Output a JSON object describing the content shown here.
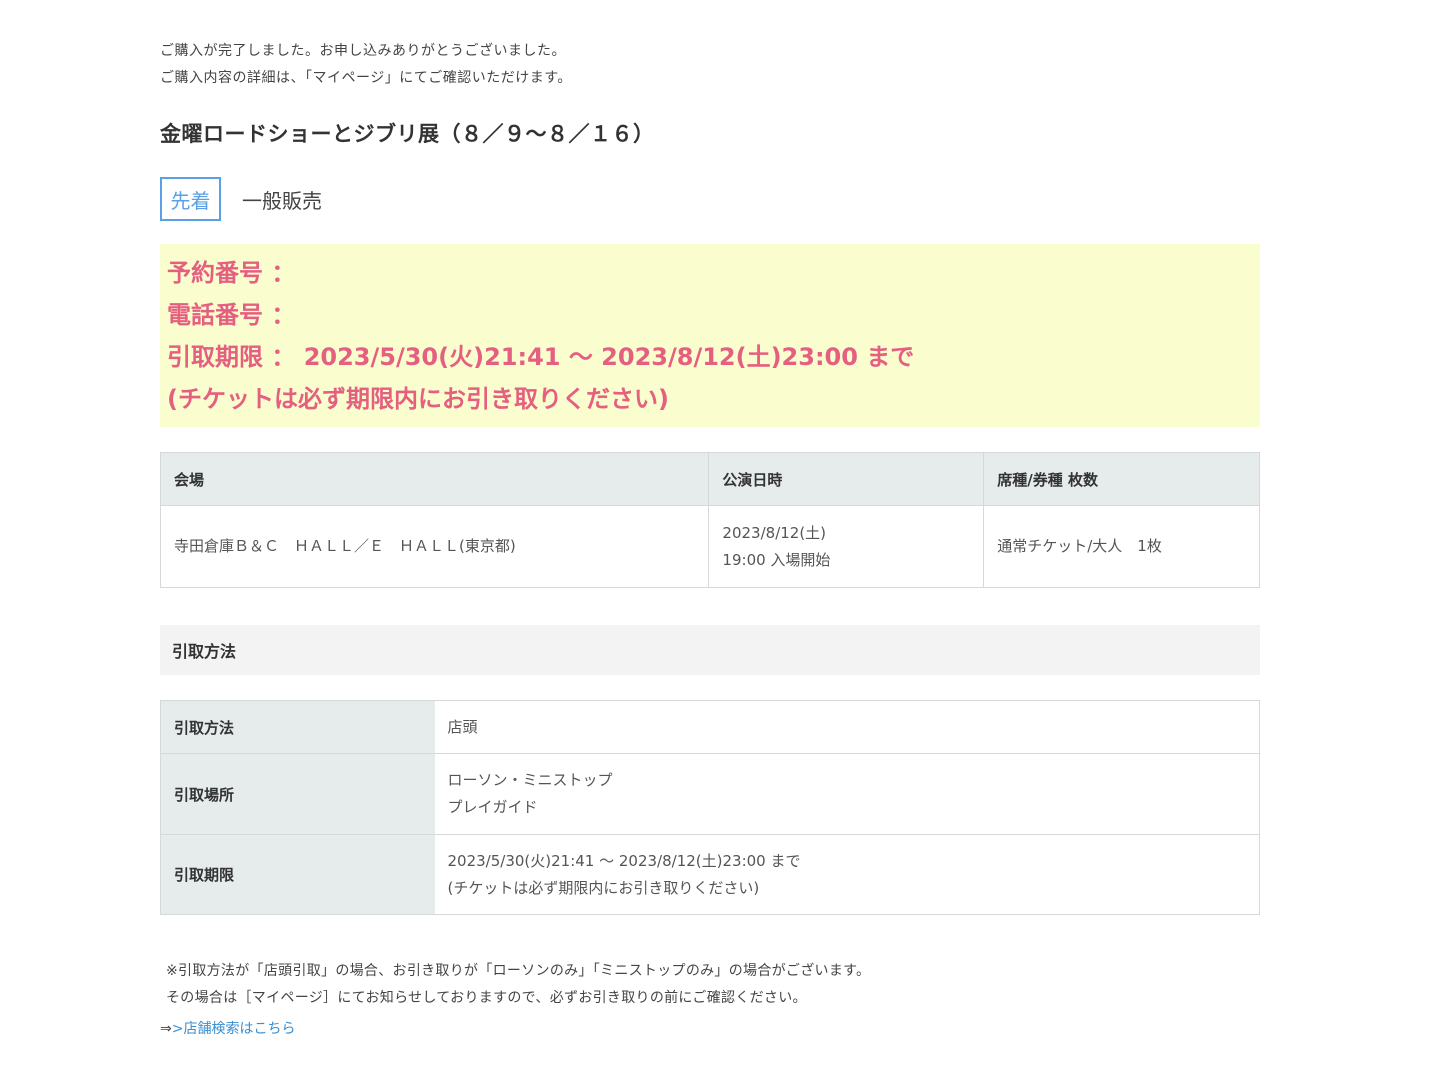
{
  "intro": {
    "line1": "ご購入が完了しました。お申し込みありがとうございました。",
    "line2": "ご購入内容の詳細は、「マイページ」にてご確認いただけます。"
  },
  "event": {
    "title": "金曜ロードショーとジブリ展（８／９～８／１６）",
    "badge": "先着",
    "sale_type": "一般販売"
  },
  "notice": {
    "reservation_number": "予約番号 ：",
    "phone_number": "電話番号 ：",
    "pickup_deadline": "引取期限 ： 2023/5/30(火)21:41 ～ 2023/8/12(土)23:00 まで",
    "pickup_note": "(チケットは必ず期限内にお引き取りください)"
  },
  "performance_table": {
    "headers": [
      "会場",
      "公演日時",
      "席種/券種 枚数"
    ],
    "venue": "寺田倉庫Ｂ＆Ｃ　ＨＡＬＬ／Ｅ　ＨＡＬＬ(東京都)",
    "date": "2023/8/12(土)",
    "time": "19:00 入場開始",
    "seat": "通常チケット/大人　1枚"
  },
  "pickup_section": {
    "heading": "引取方法",
    "rows": [
      {
        "label": "引取方法",
        "line1": "店頭",
        "line2": ""
      },
      {
        "label": "引取場所",
        "line1": "ローソン・ミニストップ",
        "line2": "プレイガイド"
      },
      {
        "label": "引取期限",
        "line1": "2023/5/30(火)21:41 ～ 2023/8/12(土)23:00 まで",
        "line2": "(チケットは必ず期限内にお引き取りください)"
      }
    ]
  },
  "footnote": {
    "line1": "※引取方法が「店頭引取」の場合、お引き取りが「ローソンのみ」「ミニストップのみ」の場合がございます。",
    "line2": "その場合は［マイページ］にてお知らせしておりますので、必ずお引き取りの前にご確認ください。",
    "link_arrow": "⇒",
    "link_text": ">店舗検索はこちら"
  },
  "colors": {
    "badge": "#5aa0e4",
    "notice_bg": "#fafdcd",
    "notice_text": "#e55f80",
    "table_header_bg": "#e6ecec",
    "link": "#3a8fd0"
  }
}
